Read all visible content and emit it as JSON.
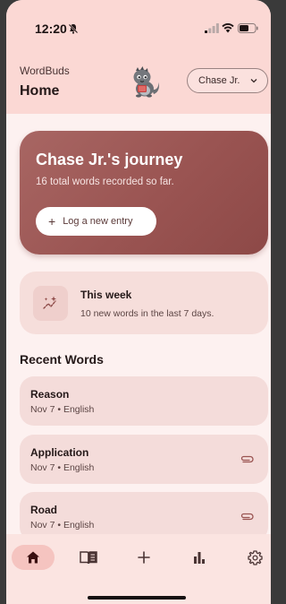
{
  "status": {
    "time": "12:20"
  },
  "header": {
    "app_name": "WordBuds",
    "title": "Home",
    "user_selected": "Chase Jr."
  },
  "hero": {
    "title": "Chase Jr.'s journey",
    "subtitle": "16 total words recorded so far.",
    "button_label": "Log a new entry"
  },
  "week": {
    "title": "This week",
    "subtitle": "10 new words in the last 7 days."
  },
  "recent": {
    "title": "Recent Words",
    "items": [
      {
        "word": "Reason",
        "meta": "Nov 7 • English",
        "attachment": false
      },
      {
        "word": "Application",
        "meta": "Nov 7 • English",
        "attachment": true
      },
      {
        "word": "Road",
        "meta": "Nov 7 • English",
        "attachment": true
      }
    ]
  },
  "nav": {
    "items": [
      {
        "icon": "home-icon",
        "active": true
      },
      {
        "icon": "book-icon",
        "active": false
      },
      {
        "icon": "plus-icon",
        "active": false
      },
      {
        "icon": "bar-chart-icon",
        "active": false
      },
      {
        "icon": "gear-icon",
        "active": false
      }
    ]
  },
  "colors": {
    "accent": "#9a5452",
    "header_bg": "#fbd8d4",
    "card_bg": "#f4dcda",
    "page_bg": "#fdf1f0"
  }
}
